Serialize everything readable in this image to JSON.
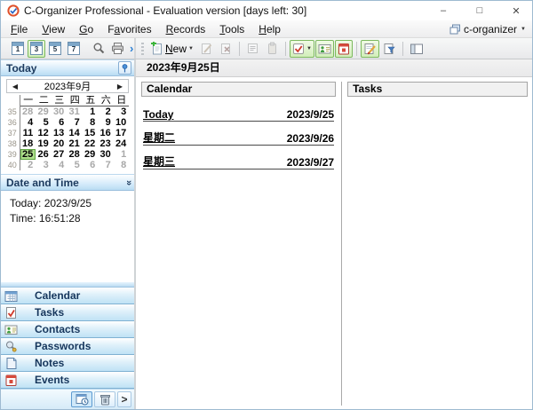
{
  "window": {
    "title": "C-Organizer Professional - Evaluation version [days left: 30]"
  },
  "icons": {
    "minimize": "–",
    "maximize": "□",
    "close": "✕",
    "prev": "◀",
    "next": "▶",
    "collapse": "»",
    "dropdown": "▼",
    "overflow": "›",
    "expand": ">"
  },
  "menubar": {
    "items": [
      {
        "label": "File",
        "u": 0
      },
      {
        "label": "View",
        "u": 0
      },
      {
        "label": "Go",
        "u": 0
      },
      {
        "label": "Favorites",
        "u": 1
      },
      {
        "label": "Records",
        "u": 0
      },
      {
        "label": "Tools",
        "u": 0
      },
      {
        "label": "Help",
        "u": 0
      }
    ],
    "right_label": "c-organizer"
  },
  "toolbar": {
    "left": {
      "day_buttons": [
        "1",
        "3",
        "5",
        "7"
      ],
      "selected_day_button": "3",
      "icon_names": [
        "day-view-icon",
        "work-week-view-icon",
        "week-view-icon",
        "month-view-icon",
        "search-icon",
        "print-icon"
      ]
    },
    "main": {
      "new": {
        "label": "New",
        "u": 0
      },
      "icon_names": [
        "new-record-icon",
        "edit-record-icon",
        "delete-record-icon",
        "show-details-icon",
        "paste-icon",
        "show-tasks-icon",
        "show-contacts-icon",
        "show-events-icon",
        "edit-mode-icon",
        "filter-icon",
        "panels-icon"
      ]
    }
  },
  "sidebar": {
    "today_panel": {
      "title": "Today",
      "calendar": {
        "month_label": "2023年9月",
        "dow": [
          "一",
          "二",
          "三",
          "四",
          "五",
          "六",
          "日"
        ],
        "weeks": [
          {
            "num": 35,
            "days": [
              {
                "d": 28,
                "m": 1
              },
              {
                "d": 29,
                "m": 1
              },
              {
                "d": 30,
                "m": 1
              },
              {
                "d": 31,
                "m": 1
              },
              {
                "d": 1
              },
              {
                "d": 2
              },
              {
                "d": 3
              }
            ]
          },
          {
            "num": 36,
            "days": [
              {
                "d": 4
              },
              {
                "d": 5
              },
              {
                "d": 6
              },
              {
                "d": 7
              },
              {
                "d": 8
              },
              {
                "d": 9
              },
              {
                "d": 10
              }
            ]
          },
          {
            "num": 37,
            "days": [
              {
                "d": 11
              },
              {
                "d": 12
              },
              {
                "d": 13
              },
              {
                "d": 14
              },
              {
                "d": 15
              },
              {
                "d": 16
              },
              {
                "d": 17
              }
            ]
          },
          {
            "num": 38,
            "days": [
              {
                "d": 18
              },
              {
                "d": 19
              },
              {
                "d": 20
              },
              {
                "d": 21
              },
              {
                "d": 22
              },
              {
                "d": 23
              },
              {
                "d": 24
              }
            ]
          },
          {
            "num": 39,
            "days": [
              {
                "d": 25,
                "sel": 1
              },
              {
                "d": 26
              },
              {
                "d": 27
              },
              {
                "d": 28
              },
              {
                "d": 29
              },
              {
                "d": 30
              },
              {
                "d": 1,
                "m": 1
              }
            ]
          },
          {
            "num": 40,
            "days": [
              {
                "d": 2,
                "m": 1
              },
              {
                "d": 3,
                "m": 1
              },
              {
                "d": 4,
                "m": 1
              },
              {
                "d": 5,
                "m": 1
              },
              {
                "d": 6,
                "m": 1
              },
              {
                "d": 7,
                "m": 1
              },
              {
                "d": 8,
                "m": 1
              }
            ]
          }
        ]
      }
    },
    "datetime_panel": {
      "title": "Date and Time",
      "today_line": "Today: 2023/9/25",
      "time_line": "Time: 16:51:28"
    },
    "nav": [
      {
        "label": "Calendar"
      },
      {
        "label": "Tasks"
      },
      {
        "label": "Contacts"
      },
      {
        "label": "Passwords"
      },
      {
        "label": "Notes"
      },
      {
        "label": "Events"
      }
    ],
    "bottom_icon_names": [
      "calendar-clock-icon",
      "recycle-bin-icon",
      "expand-chevron"
    ]
  },
  "main": {
    "date_header": "2023年9月25日",
    "calendar_panel": {
      "title": "Calendar",
      "rows": [
        {
          "label": "Today",
          "date": "2023/9/25"
        },
        {
          "label": "星期二",
          "date": "2023/9/26"
        },
        {
          "label": "星期三",
          "date": "2023/9/27"
        }
      ]
    },
    "tasks_panel": {
      "title": "Tasks"
    }
  },
  "colors": {
    "selected_day_bg": "#aede8c",
    "selected_day_border": "#5da53f",
    "toggle_green_bg": "#d2eeba",
    "toggle_green_border": "#7cb95e",
    "panel_header_blue": "#b9dcf3",
    "nav_text": "#16365c"
  }
}
